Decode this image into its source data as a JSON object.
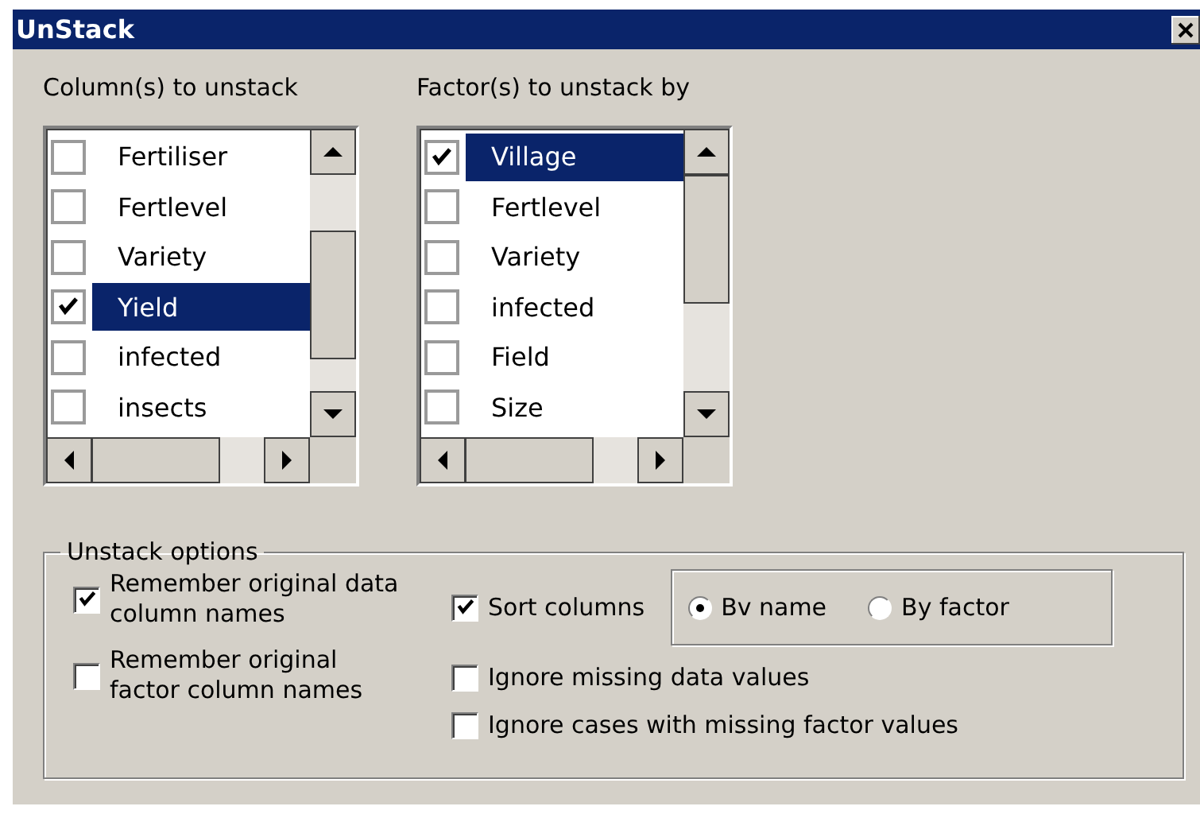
{
  "window": {
    "title": "UnStack"
  },
  "columns_list": {
    "label": "Column(s) to unstack",
    "items": [
      {
        "label": "Fertiliser",
        "checked": false,
        "selected": false
      },
      {
        "label": "Fertlevel",
        "checked": false,
        "selected": false
      },
      {
        "label": "Variety",
        "checked": false,
        "selected": false
      },
      {
        "label": "Yield",
        "checked": true,
        "selected": true
      },
      {
        "label": "infected",
        "checked": false,
        "selected": false
      },
      {
        "label": "insects",
        "checked": false,
        "selected": false
      }
    ]
  },
  "factors_list": {
    "label": "Factor(s) to unstack by",
    "items": [
      {
        "label": "Village",
        "checked": true,
        "selected": true
      },
      {
        "label": "Fertlevel",
        "checked": false,
        "selected": false
      },
      {
        "label": "Variety",
        "checked": false,
        "selected": false
      },
      {
        "label": "infected",
        "checked": false,
        "selected": false
      },
      {
        "label": "Field",
        "checked": false,
        "selected": false
      },
      {
        "label": "Size",
        "checked": false,
        "selected": false
      }
    ]
  },
  "options": {
    "title": "Unstack options",
    "remember": [
      {
        "label": "Remember original data column names",
        "checked": true
      },
      {
        "label": "Remember original factor column names",
        "checked": false
      }
    ],
    "sort_columns": {
      "label": "Sort columns",
      "checked": true
    },
    "sort_by": [
      {
        "label": "Bv name",
        "selected": true
      },
      {
        "label": "By factor",
        "selected": false
      }
    ],
    "ignore": [
      {
        "label": "Ignore missing data values",
        "checked": false
      },
      {
        "label": "Ignore cases with missing factor values",
        "checked": false
      }
    ]
  }
}
